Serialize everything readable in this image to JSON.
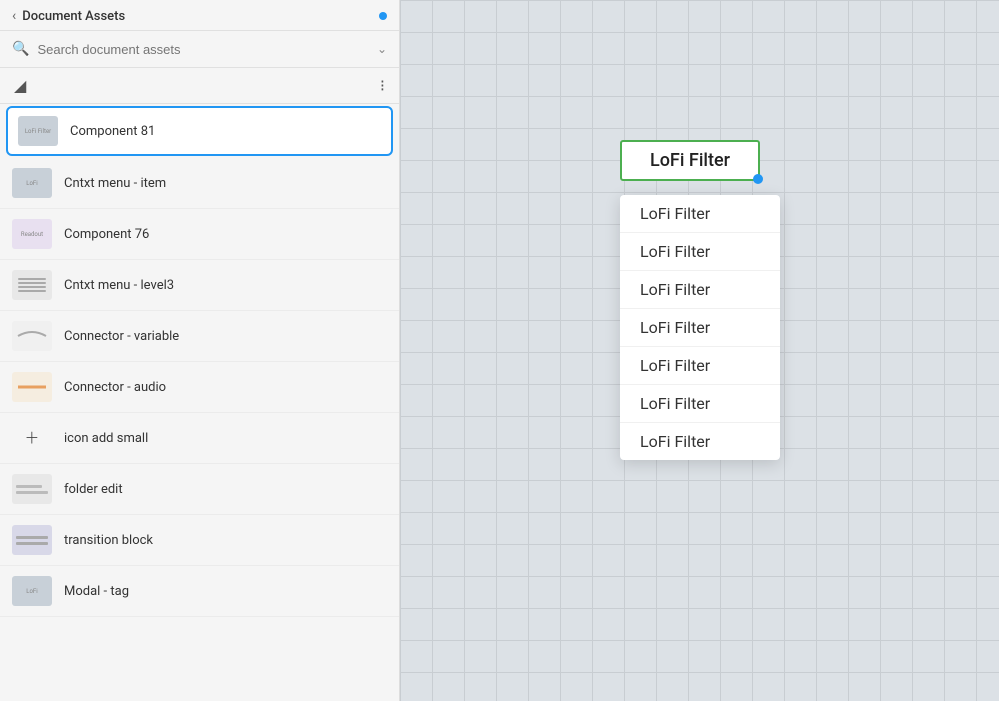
{
  "sidebar": {
    "title": "Document Assets",
    "blue_dot": true,
    "search": {
      "placeholder": "Search document assets",
      "value": ""
    },
    "components": [
      {
        "id": "comp-81",
        "name": "Component 81",
        "thumb": "lofi",
        "selected": true
      },
      {
        "id": "cntxt-menu-item",
        "name": "Cntxt menu - item",
        "thumb": "lofi",
        "selected": false
      },
      {
        "id": "comp-76",
        "name": "Component 76",
        "thumb": "readout",
        "selected": false
      },
      {
        "id": "cntxt-menu-level3",
        "name": "Cntxt menu - level3",
        "thumb": "lines",
        "selected": false
      },
      {
        "id": "connector-variable",
        "name": "Connector - variable",
        "thumb": "connector-var",
        "selected": false
      },
      {
        "id": "connector-audio",
        "name": "Connector - audio",
        "thumb": "connector-audio",
        "selected": false
      },
      {
        "id": "icon-add-small",
        "name": "icon add small",
        "thumb": "plus",
        "selected": false
      },
      {
        "id": "folder-edit",
        "name": "folder edit",
        "thumb": "folder",
        "selected": false
      },
      {
        "id": "transition-block",
        "name": "transition block",
        "thumb": "transition",
        "selected": false
      },
      {
        "id": "modal-tag",
        "name": "Modal - tag",
        "thumb": "lofi",
        "selected": false
      }
    ]
  },
  "canvas": {
    "selected_label": "LoFi Filter",
    "dropdown_items": [
      "LoFi Filter",
      "LoFi Filter",
      "LoFi Filter",
      "LoFi Filter",
      "LoFi Filter",
      "LoFi Filter",
      "LoFi Filter"
    ]
  }
}
